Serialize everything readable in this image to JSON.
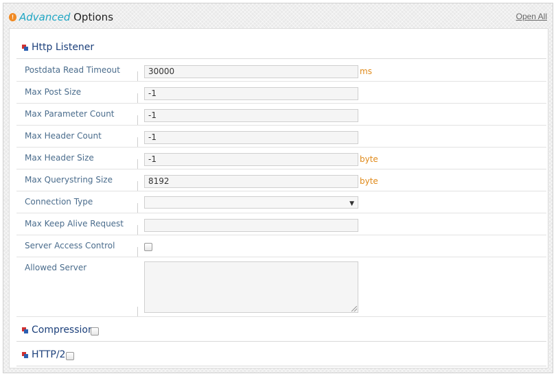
{
  "header": {
    "title_accent": "Advanced",
    "title_rest": " Options",
    "open_all": "Open All"
  },
  "sections": {
    "http_listener": {
      "label": "Http Listener"
    },
    "compression": {
      "label": "Compression",
      "checked": false
    },
    "http2": {
      "label": "HTTP/2",
      "checked": false
    }
  },
  "fields": {
    "postdata_read_timeout": {
      "label": "Postdata Read Timeout",
      "value": "30000",
      "unit": "ms"
    },
    "max_post_size": {
      "label": "Max Post Size",
      "value": "-1"
    },
    "max_parameter_count": {
      "label": "Max Parameter Count",
      "value": "-1"
    },
    "max_header_count": {
      "label": "Max Header Count",
      "value": "-1"
    },
    "max_header_size": {
      "label": "Max Header Size",
      "value": "-1",
      "unit": "byte"
    },
    "max_querystring_size": {
      "label": "Max Querystring Size",
      "value": "8192",
      "unit": "byte"
    },
    "connection_type": {
      "label": "Connection Type",
      "value": ""
    },
    "max_keep_alive_request": {
      "label": "Max Keep Alive Request",
      "value": ""
    },
    "server_access_control": {
      "label": "Server Access Control",
      "checked": false
    },
    "allowed_server": {
      "label": "Allowed Server",
      "value": ""
    }
  },
  "icons": {
    "header": "warning-icon",
    "section": "section-bullet-icon",
    "select": "chevron-down-icon"
  },
  "colors": {
    "title_accent": "#1fa6c4",
    "section_label": "#1b3f7a",
    "field_label": "#4a6c8c",
    "unit": "#e08a1a"
  }
}
